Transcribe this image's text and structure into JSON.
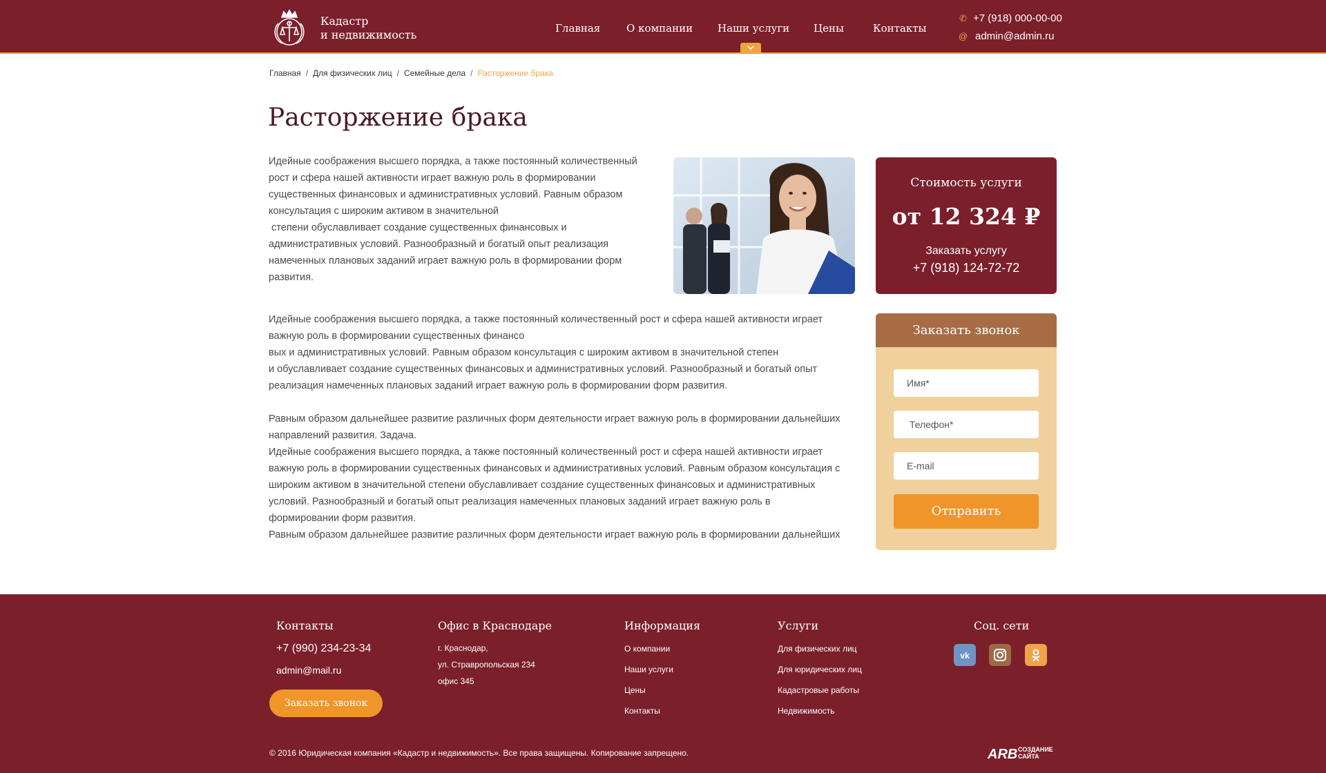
{
  "header": {
    "logo_line1": "Кадастр",
    "logo_line2": "и недвижимость",
    "nav": [
      {
        "label": "Главная"
      },
      {
        "label": "О компании"
      },
      {
        "label": "Наши услуги"
      },
      {
        "label": "Цены"
      },
      {
        "label": "Контакты"
      }
    ],
    "phone": "+7 (918) 000-00-00",
    "email": "admin@admin.ru",
    "phone_icon": "phone-icon",
    "email_icon": "at-icon"
  },
  "breadcrumb": [
    {
      "label": "Главная"
    },
    {
      "label": "Для физических лиц"
    },
    {
      "label": "Семейные дела"
    },
    {
      "label": "Расторжение брака"
    }
  ],
  "page": {
    "title": "Расторжение брака",
    "intro_lines": [
      "Идейные соображения высшего порядка, а также постоянный количественный",
      "рост и сфера нашей активности играет важную роль в формировании",
      "существенных финансовых и административных условий. Равным образом",
      "консультация с широким активом в значительной",
      " степени обуславливает создание существенных финансовых и",
      "административных условий. Разнообразный и богатый опыт реализация",
      "намеченных плановых заданий играет важную роль в формировании форм",
      "развития."
    ],
    "para1_lines": [
      "Идейные соображения высшего порядка, а также постоянный количественный рост и сфера нашей активности играет",
      "важную роль в формировании существенных финансо",
      "вых и административных условий. Равным образом консультация с широким активом в значительной степен",
      "и обуславливает создание существенных финансовых и административных условий. Разнообразный и богатый опыт",
      "реализация намеченных плановых заданий играет важную роль в формировании форм развития."
    ],
    "para2_lines": [
      "Равным образом дальнейшее развитие различных форм деятельности играет важную роль в формировании дальнейших",
      "направлений развития. Задача.",
      "Идейные соображения высшего порядка, а также постоянный количественный рост и сфера нашей активности играет",
      "важную роль в формировании существенных финансовых и административных условий. Равным образом консультация с",
      "широким активом в значительной степени обуславливает создание существенных финансовых и административных",
      "условий. Разнообразный и богатый опыт реализация намеченных плановых заданий играет важную роль в",
      "формировании форм развития.",
      "Равным образом дальнейшее развитие различных форм деятельности играет важную роль в формировании дальнейших"
    ]
  },
  "price": {
    "label": "Стоимость услуги",
    "value": "от 12 324 ₽",
    "order_label": "Заказать услугу",
    "phone": "+7 (918) 124-72-72"
  },
  "callback": {
    "title": "Заказать звонок",
    "name_placeholder": "Имя*",
    "phone_placeholder": " Телефон*",
    "email_placeholder": "E-mail",
    "submit_label": "Отправить"
  },
  "footer": {
    "contacts_title": "Контакты",
    "phone": "+7 (990)  234-23-34",
    "email": "admin@mail.ru",
    "callback_button": "Заказать звонок",
    "office_title": "Офис в Краснодаре",
    "address_lines": [
      "г. Краснодар,",
      "ул. Стравропольская 234",
      "офис 345"
    ],
    "info_title": "Информация",
    "info_links": [
      "О компании",
      "Наши услуги",
      "Цены",
      "Контакты"
    ],
    "services_title": "Услуги",
    "services_links": [
      "Для физических лиц",
      "Для юридических лиц",
      "Кадастровые работы",
      "Недвижимость"
    ],
    "social_title": "Соц. сети",
    "social": [
      {
        "icon": "vk-icon",
        "color": "#6f95c4"
      },
      {
        "icon": "instagram-icon",
        "color": "#9c6a44"
      },
      {
        "icon": "odnoklassniki-icon",
        "color": "#f0a34a"
      }
    ],
    "copyright": "© 2016 Юридическая компания «Кадастр и недвижимость». Все права защищены. Копирование запрещено.",
    "dev_line1": "СОЗДАНИЕ",
    "dev_line2": "САЙТА"
  },
  "colors": {
    "brand": "#7b1f2b",
    "accent": "#f0952a",
    "form_bg": "#f0d09c",
    "form_head": "#a86c45"
  }
}
